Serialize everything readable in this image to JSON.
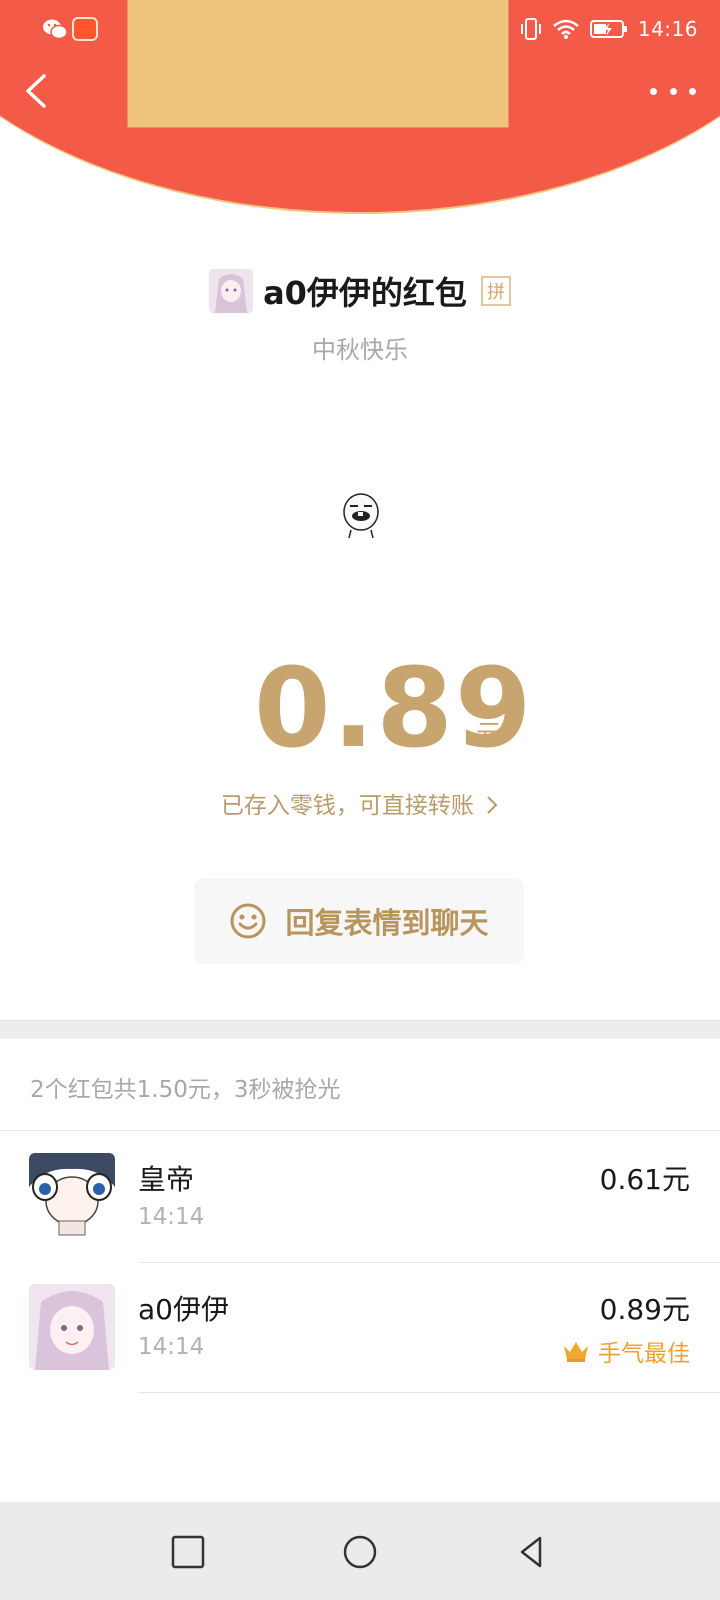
{
  "status_bar": {
    "time": "14:16",
    "icons": [
      "wechat-icon",
      "notification-app-icon",
      "vibrate-icon",
      "wifi-icon",
      "battery-charging-icon"
    ]
  },
  "nav": {
    "back_icon": "chevron-left-icon",
    "more_icon": "more-dots-icon"
  },
  "red_packet": {
    "sender_title": "a0伊伊的红包",
    "pin_badge": "拼",
    "greeting": "中秋快乐",
    "amount": "0.89",
    "unit": "元",
    "deposit_link": "已存入零钱，可直接转账",
    "reply_button": "回复表情到聊天"
  },
  "summary": "2个红包共1.50元，3秒被抢光",
  "entries": [
    {
      "name": "皇帝",
      "time": "14:14",
      "amount": "0.61元",
      "badge": ""
    },
    {
      "name": "a0伊伊",
      "time": "14:14",
      "amount": "0.89元",
      "badge": "手气最佳"
    }
  ],
  "colors": {
    "header_red": "#f35a48",
    "gold": "#c8a46e",
    "best_orange": "#f0a030"
  }
}
